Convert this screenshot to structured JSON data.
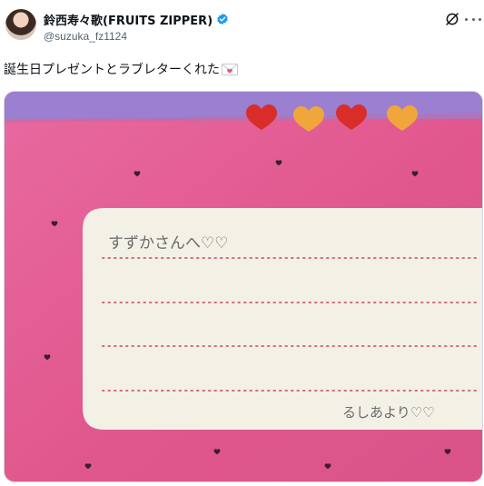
{
  "post": {
    "display_name": "鈴西寿々歌(FRUITS ZIPPER)",
    "handle": "@suzuka_fz1124",
    "text": "誕生日プレゼントとラブレターくれた",
    "text_emoji": "love-letter-icon"
  },
  "media": {
    "letter_text": "すずかさんへ♡♡",
    "signature_text": "るしあより♡♡"
  },
  "icons": {
    "verified": "verified-badge-icon",
    "grok": "grok-icon",
    "more": "more-icon"
  },
  "colors": {
    "verified": "#1d9bf0",
    "pink_paper": "#e25c8f",
    "purple_strip": "#9b7fd0",
    "note_card": "#f2efe4",
    "dot_line": "#d46a85"
  }
}
